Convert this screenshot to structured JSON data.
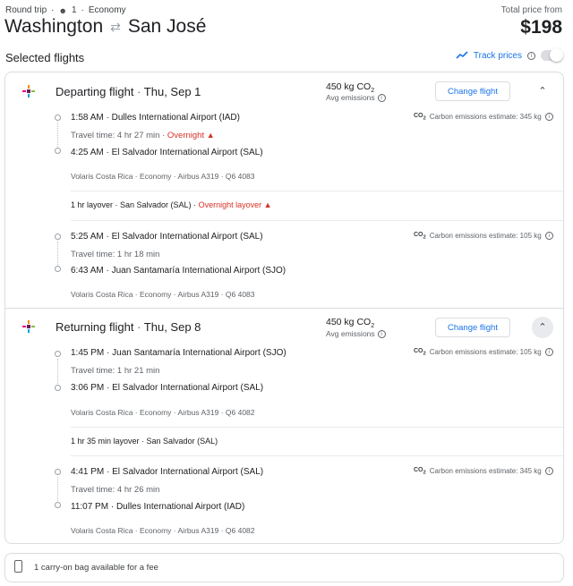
{
  "header": {
    "trip_type": "Round trip",
    "passengers": "1",
    "cabin": "Economy",
    "origin": "Washington",
    "destination": "San José",
    "price_label": "Total price from",
    "price": "$198"
  },
  "selected": {
    "title": "Selected flights",
    "track_prices": "Track prices"
  },
  "departing": {
    "title": "Departing flight",
    "date": "Thu, Sep 1",
    "emissions_value": "450 kg CO",
    "emissions_sub": "2",
    "emissions_label": "Avg emissions",
    "change_label": "Change flight",
    "seg1": {
      "dep_time": "1:58 AM",
      "dep_airport": "Dulles International Airport (IAD)",
      "travel_time": "Travel time: 4 hr 27 min",
      "overnight": "Overnight",
      "arr_time": "4:25 AM",
      "arr_airport": "El Salvador International Airport (SAL)",
      "details": "Volaris Costa Rica · Economy · Airbus A319 · Q6 4083",
      "co2": "Carbon emissions estimate: 345 kg"
    },
    "layover": "1 hr layover · San Salvador (SAL)",
    "layover_warning": "Overnight layover",
    "seg2": {
      "dep_time": "5:25 AM",
      "dep_airport": "El Salvador International Airport (SAL)",
      "travel_time": "Travel time: 1 hr 18 min",
      "arr_time": "6:43 AM",
      "arr_airport": "Juan Santamaría International Airport (SJO)",
      "details": "Volaris Costa Rica · Economy · Airbus A319 · Q6 4083",
      "co2": "Carbon emissions estimate: 105 kg"
    }
  },
  "returning": {
    "title": "Returning flight",
    "date": "Thu, Sep 8",
    "emissions_value": "450 kg CO",
    "emissions_sub": "2",
    "emissions_label": "Avg emissions",
    "change_label": "Change flight",
    "seg1": {
      "dep_time": "1:45 PM",
      "dep_airport": "Juan Santamaría International Airport (SJO)",
      "travel_time": "Travel time: 1 hr 21 min",
      "arr_time": "3:06 PM",
      "arr_airport": "El Salvador International Airport (SAL)",
      "details": "Volaris Costa Rica · Economy · Airbus A319 · Q6 4082",
      "co2": "Carbon emissions estimate: 105 kg"
    },
    "layover": "1 hr 35 min layover · San Salvador (SAL)",
    "seg2": {
      "dep_time": "4:41 PM",
      "dep_airport": "El Salvador International Airport (SAL)",
      "travel_time": "Travel time: 4 hr 26 min",
      "arr_time": "11:07 PM",
      "arr_airport": "Dulles International Airport (IAD)",
      "details": "Volaris Costa Rica · Economy · Airbus A319 · Q6 4082",
      "co2": "Carbon emissions estimate: 345 kg"
    }
  },
  "baggage": {
    "text": "1 carry-on bag available for a fee"
  },
  "icons": {
    "airline_logo": "volaris-logo-icon",
    "passenger": "person-icon",
    "swap": "swap-arrows-icon",
    "trend": "trend-line-icon",
    "info": "info-icon",
    "warning": "warning-triangle-icon",
    "co2": "co2-icon",
    "collapse": "chevron-up-icon",
    "bag": "carry-on-bag-icon"
  },
  "colors": {
    "accent": "#1a73e8",
    "warning": "#d93025",
    "border": "#dadce0"
  }
}
